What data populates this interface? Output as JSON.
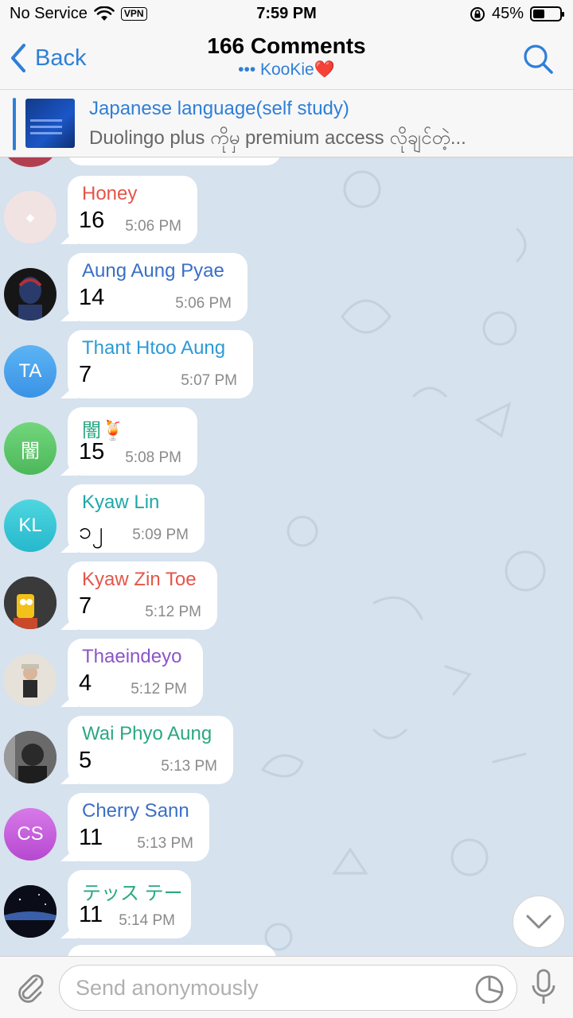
{
  "status_bar": {
    "carrier": "No Service",
    "vpn": "VPN",
    "time": "7:59 PM",
    "battery": "45%",
    "battery_level": 0.45
  },
  "nav": {
    "back_label": "Back",
    "title": "166 Comments",
    "subtitle": "••• KooKie❤️"
  },
  "pinned": {
    "title": "Japanese language(self study)",
    "text": "Duolingo plus ကိုမှ premium access လိုချင်တဲ့..."
  },
  "messages": [
    {
      "sender": "Honey",
      "sender_color": "#e5554a",
      "text": "16",
      "time": "5:06 PM",
      "avatar_type": "photo",
      "avatar_color": "#f2e3e3"
    },
    {
      "sender": "Aung Aung Pyae",
      "sender_color": "#3a6fc8",
      "text": "14",
      "time": "5:06 PM",
      "avatar_type": "photo",
      "avatar_color": "#161616"
    },
    {
      "sender": "Thant Htoo Aung",
      "sender_color": "#2d9ad6",
      "text": "7",
      "time": "5:07 PM",
      "avatar_type": "initials",
      "avatar_initials": "TA",
      "avatar_color": "#4aa6ef"
    },
    {
      "sender": "闇🍹",
      "sender_color": "#2aa882",
      "text": "15",
      "time": "5:08 PM",
      "avatar_type": "initials",
      "avatar_initials": "闇",
      "avatar_color": "#5cc76a"
    },
    {
      "sender": "Kyaw Lin",
      "sender_color": "#1fa8a8",
      "text": "၁၂",
      "time": "5:09 PM",
      "avatar_type": "initials",
      "avatar_initials": "KL",
      "avatar_color": "#36c6d6"
    },
    {
      "sender": "Kyaw Zin Toe",
      "sender_color": "#e5554a",
      "text": "7",
      "time": "5:12 PM",
      "avatar_type": "photo",
      "avatar_color": "#2b2b2b"
    },
    {
      "sender": "Thaeindeyo",
      "sender_color": "#8b55c8",
      "text": "4",
      "time": "5:12 PM",
      "avatar_type": "photo",
      "avatar_color": "#e8e0d6"
    },
    {
      "sender": "Wai Phyo Aung",
      "sender_color": "#2aa882",
      "text": "5",
      "time": "5:13 PM",
      "avatar_type": "photo",
      "avatar_color": "#555555"
    },
    {
      "sender": "Cherry Sann",
      "sender_color": "#3a6fc8",
      "text": "11",
      "time": "5:13 PM",
      "avatar_type": "initials",
      "avatar_initials": "CS",
      "avatar_color": "#c45cdc"
    },
    {
      "sender": "テッス テー",
      "sender_color": "#2aa882",
      "text": "11",
      "time": "5:14 PM",
      "avatar_type": "photo",
      "avatar_color": "#0b1020"
    }
  ],
  "composer": {
    "placeholder": "Send anonymously"
  },
  "icons": {
    "back": "chevron-left-icon",
    "search": "search-icon",
    "wifi": "wifi-icon",
    "lock": "orientation-lock-icon",
    "scroll_down": "chevron-down-icon",
    "attach": "paperclip-icon",
    "sticker": "sticker-icon",
    "mic": "microphone-icon"
  },
  "colors": {
    "accent": "#2f7fd8",
    "chat_background": "#d6e2ed"
  }
}
